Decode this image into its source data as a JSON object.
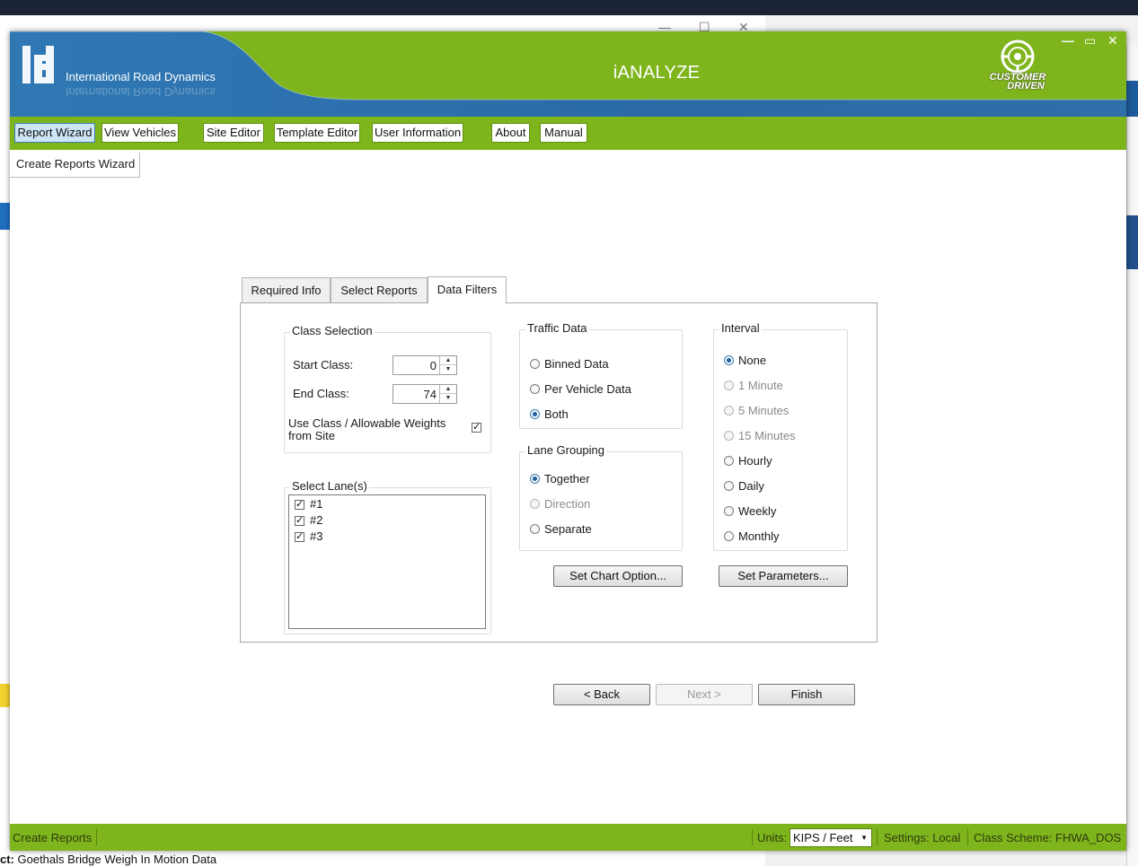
{
  "app": {
    "title": "iANALYZE",
    "company": "International Road Dynamics",
    "badge_line1": "CUSTOMER",
    "badge_line2": "DRIVEN"
  },
  "toolbar": {
    "buttons": [
      {
        "label": "Report Wizard",
        "active": true
      },
      {
        "label": "View Vehicles"
      },
      {
        "label": "Site Editor"
      },
      {
        "label": "Template Editor"
      },
      {
        "label": "User Information"
      },
      {
        "label": "About"
      },
      {
        "label": "Manual"
      }
    ]
  },
  "wizard_tab": "Create Reports Wizard",
  "tabs": [
    "Required Info",
    "Select Reports",
    "Data Filters"
  ],
  "selected_tab": "Data Filters",
  "class_selection": {
    "title": "Class Selection",
    "start_label": "Start Class:",
    "start_value": "0",
    "end_label": "End Class:",
    "end_value": "74",
    "use_weights_label_1": "Use Class / Allowable Weights",
    "use_weights_label_2": "from Site",
    "use_weights_checked": true
  },
  "lanes": {
    "title": "Select Lane(s)",
    "items": [
      {
        "label": "#1",
        "checked": true
      },
      {
        "label": "#2",
        "checked": true
      },
      {
        "label": "#3",
        "checked": true
      }
    ]
  },
  "traffic_data": {
    "title": "Traffic Data",
    "options": [
      "Binned Data",
      "Per Vehicle Data",
      "Both"
    ],
    "selected": "Both"
  },
  "lane_grouping": {
    "title": "Lane Grouping",
    "options": [
      "Together",
      "Direction",
      "Separate"
    ],
    "selected": "Together",
    "disabled": [
      "Direction"
    ]
  },
  "interval": {
    "title": "Interval",
    "options": [
      "None",
      "1 Minute",
      "5 Minutes",
      "15 Minutes",
      "Hourly",
      "Daily",
      "Weekly",
      "Monthly"
    ],
    "selected": "None",
    "disabled": [
      "1 Minute",
      "5 Minutes",
      "15 Minutes"
    ]
  },
  "buttons": {
    "chart_option": "Set Chart Option...",
    "parameters": "Set Parameters...",
    "back": "< Back",
    "next": "Next >",
    "finish": "Finish"
  },
  "status": {
    "left": "Create Reports",
    "units_label": "Units:",
    "units_value": "KIPS / Feet",
    "settings": "Settings: Local",
    "class_scheme": "Class Scheme: FHWA_DOS"
  },
  "background": {
    "bottom_text_bold": "ct:",
    "bottom_text": " Goethals Bridge Weigh In Motion Data"
  },
  "colors": {
    "green": "#7fb51c",
    "blue": "#2f6ea8"
  }
}
